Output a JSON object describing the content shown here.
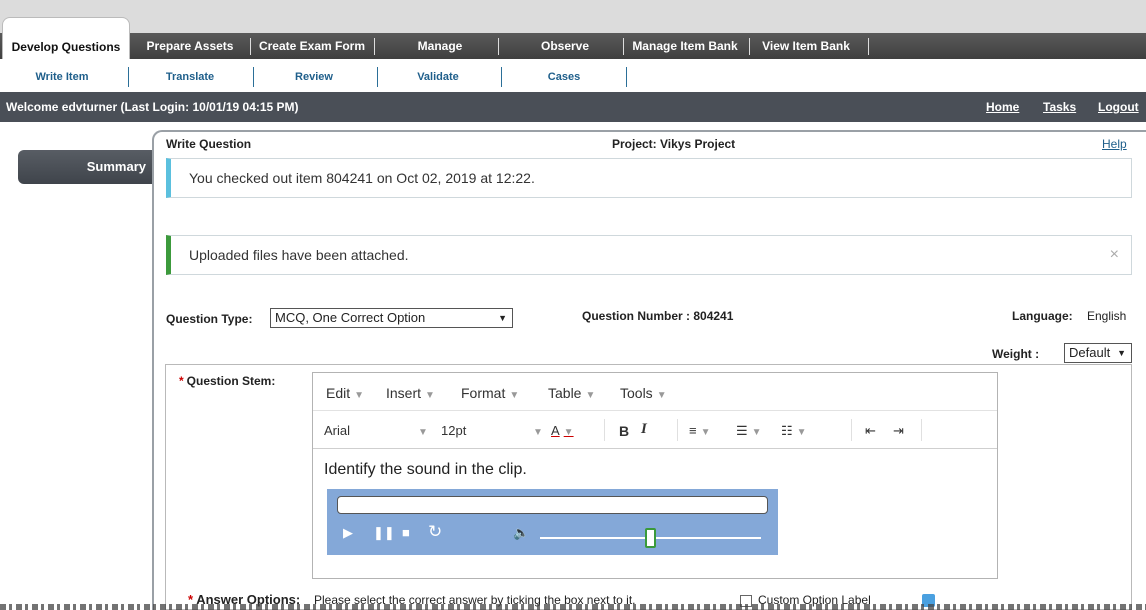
{
  "main_tabs": [
    "Develop Questions",
    "Prepare Assets",
    "Create Exam Form",
    "Manage",
    "Observe",
    "Manage Item Bank",
    "View Item Bank"
  ],
  "sub_tabs": [
    "Write Item",
    "Translate",
    "Review",
    "Validate",
    "Cases"
  ],
  "welcome": {
    "message": "Welcome edvturner (Last Login: 10/01/19   04:15 PM)",
    "links": [
      "Home",
      "Tasks",
      "Logout"
    ]
  },
  "sidebar": {
    "summary_label": "Summary"
  },
  "header": {
    "title": "Write Question",
    "project": "Project: Vikys Project",
    "help": "Help"
  },
  "alerts": {
    "checkout": "You checked out item 804241 on Oct 02, 2019 at 12:22.",
    "uploaded": "Uploaded files have been attached.",
    "close": "×"
  },
  "question": {
    "type_label": "Question Type:",
    "type_value": "MCQ, One Correct Option",
    "number_label": "Question Number : 804241",
    "language_label": "Language:",
    "language_value": "English",
    "weight_label": "Weight :",
    "weight_value": "Default",
    "stem_label": "Question Stem:",
    "stem_required": "*"
  },
  "editor": {
    "menus": [
      "Edit",
      "Insert",
      "Format",
      "Table",
      "Tools"
    ],
    "font_family": "Arial",
    "font_size": "12pt",
    "bold": "B",
    "italic": "I",
    "text_color": "A",
    "content": "Identify the sound in the clip."
  },
  "answer_options": {
    "label": "Answer Options:",
    "required": "*",
    "help": "Please select the correct answer by ticking the box next to it.",
    "custom_label": "Custom Option Label"
  },
  "colors": {
    "nav_bar": "#4a4f57",
    "sub_tab_text": "#1f5f8b",
    "info_border": "#5bc0de",
    "success_border": "#3c9a3c",
    "audio_player": "#84a8d8"
  },
  "icons": {
    "play": "play-icon",
    "pause": "pause-icon",
    "stop": "stop-icon",
    "replay": "replay-icon",
    "volume": "volume-icon",
    "info": "info-icon"
  }
}
